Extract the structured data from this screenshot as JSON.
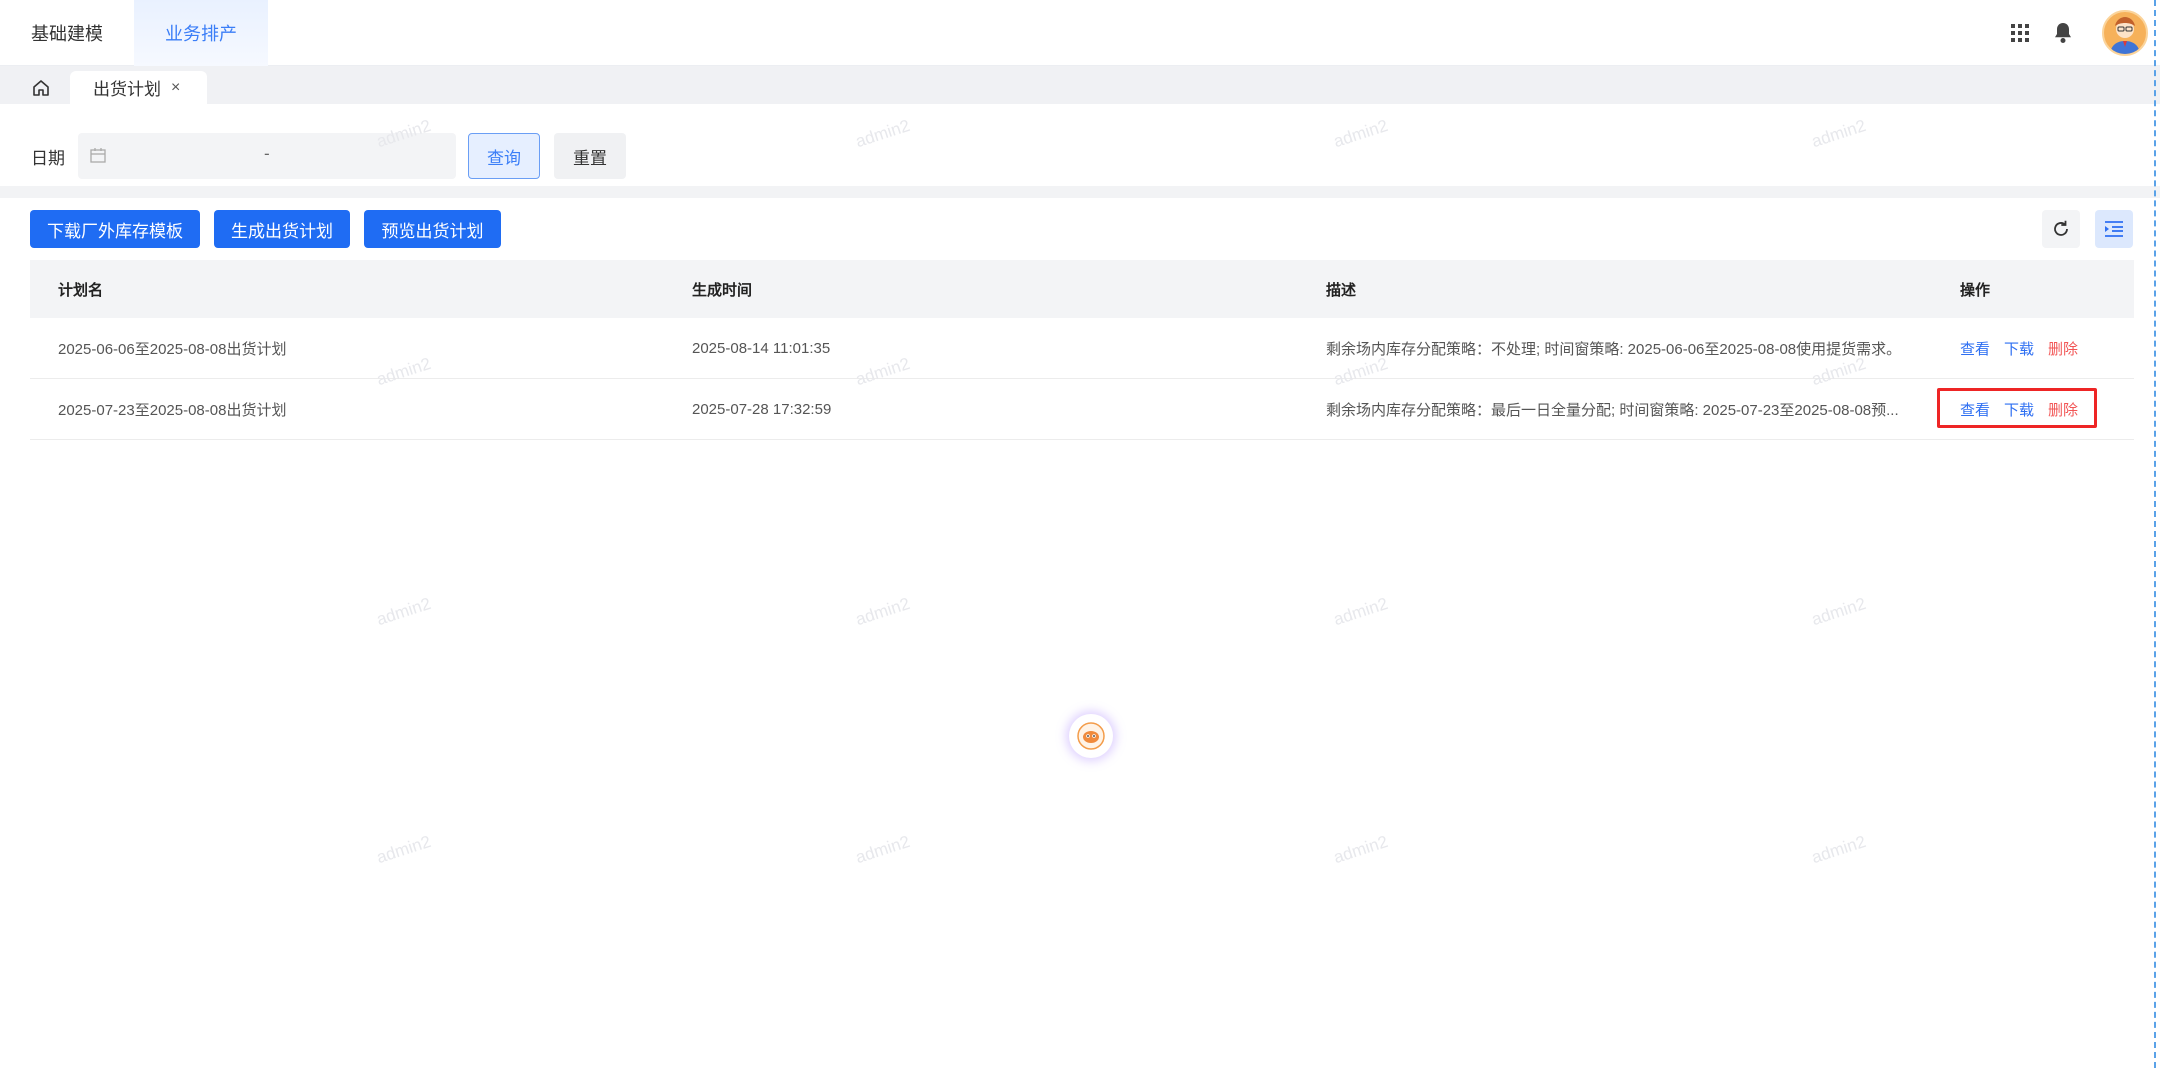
{
  "topnav": {
    "items": [
      {
        "label": "基础建模",
        "active": false
      },
      {
        "label": "业务排产",
        "active": true
      }
    ]
  },
  "header_icons": [
    "apps-grid-icon",
    "bell-icon",
    "user-avatar"
  ],
  "tabs": {
    "home_icon": "home-icon",
    "open": [
      {
        "label": "出货计划",
        "close": "×"
      }
    ]
  },
  "filter": {
    "date_label": "日期",
    "date_separator": "-",
    "query_label": "查询",
    "reset_label": "重置"
  },
  "toolbar": {
    "download_template_label": "下载厂外库存模板",
    "generate_label": "生成出货计划",
    "preview_label": "预览出货计划",
    "refresh_icon": "refresh-icon",
    "column_settings_icon": "column-settings-icon"
  },
  "table": {
    "columns": [
      "计划名",
      "生成时间",
      "描述",
      "操作"
    ],
    "rows": [
      {
        "name": "2025-06-06至2025-08-08出货计划",
        "time": "2025-08-14 11:01:35",
        "desc": "剩余场内库存分配策略：不处理; 时间窗策略: 2025-06-06至2025-08-08使用提货需求。",
        "actions": {
          "view": "查看",
          "download": "下载",
          "delete": "删除"
        }
      },
      {
        "name": "2025-07-23至2025-08-08出货计划",
        "time": "2025-07-28 17:32:59",
        "desc": "剩余场内库存分配策略：最后一日全量分配; 时间窗策略: 2025-07-23至2025-08-08预...",
        "actions": {
          "view": "查看",
          "download": "下载",
          "delete": "删除"
        }
      }
    ]
  },
  "watermark": "admin2",
  "colors": {
    "primary": "#1f6cf3",
    "link": "#2e6ff2",
    "danger": "#f25555",
    "highlight_box": "#ee2525"
  }
}
